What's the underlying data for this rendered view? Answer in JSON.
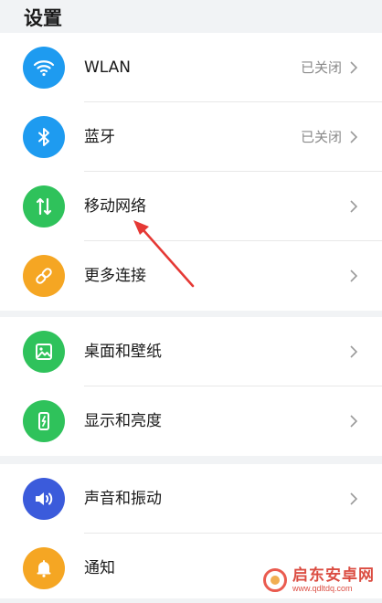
{
  "header": {
    "title": "设置"
  },
  "groups": [
    {
      "items": [
        {
          "label": "WLAN",
          "status": "已关闭",
          "icon": "wifi-icon",
          "color": "#1e9bf0"
        },
        {
          "label": "蓝牙",
          "status": "已关闭",
          "icon": "bluetooth-icon",
          "color": "#1e9bf0"
        },
        {
          "label": "移动网络",
          "status": "",
          "icon": "mobile-data-icon",
          "color": "#2fc25b"
        },
        {
          "label": "更多连接",
          "status": "",
          "icon": "link-icon",
          "color": "#f5a623"
        }
      ]
    },
    {
      "items": [
        {
          "label": "桌面和壁纸",
          "status": "",
          "icon": "wallpaper-icon",
          "color": "#2fc25b"
        },
        {
          "label": "显示和亮度",
          "status": "",
          "icon": "display-brightness-icon",
          "color": "#2fc25b"
        }
      ]
    },
    {
      "items": [
        {
          "label": "声音和振动",
          "status": "",
          "icon": "volume-icon",
          "color": "#3b5bdb"
        },
        {
          "label": "通知",
          "status": "",
          "icon": "bell-icon",
          "color": "#f5a623"
        }
      ]
    }
  ],
  "annotation": {
    "arrow_color": "#e53935"
  },
  "watermark": {
    "title": "启东安卓网",
    "url": "www.qdltdq.com"
  }
}
